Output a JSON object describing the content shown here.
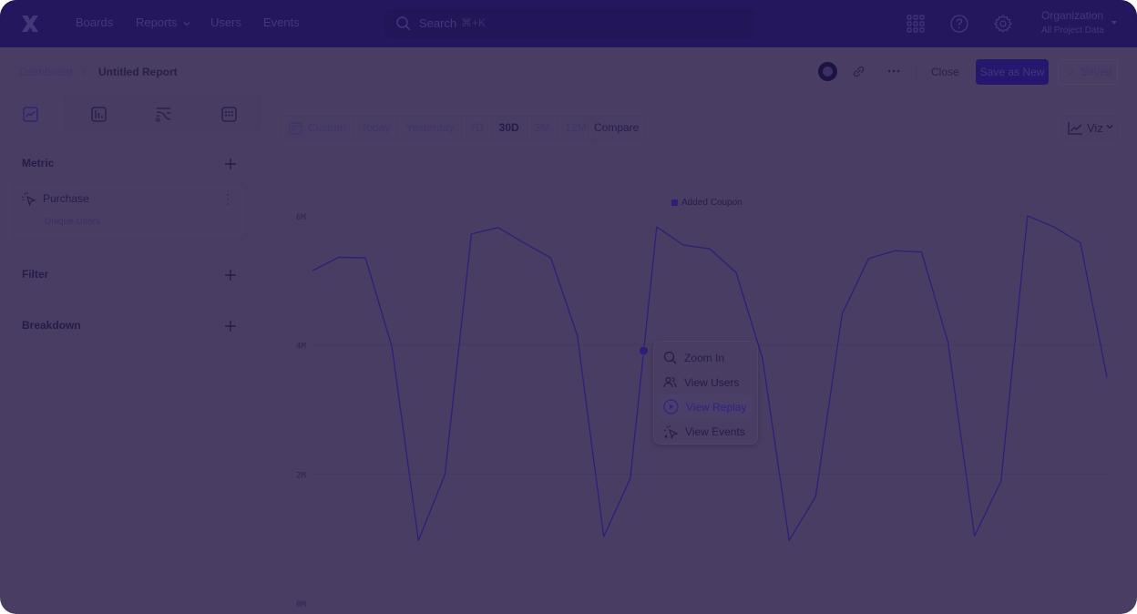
{
  "topnav": {
    "logo": "x-logo-icon",
    "links": [
      "Boards",
      "Reports",
      "Users",
      "Events"
    ],
    "search_placeholder": "Search",
    "search_shortcut": "⌘+K",
    "org_name": "Organization",
    "org_sub": "All Project Data"
  },
  "header": {
    "breadcrumb_root": "Dashboard",
    "breadcrumb_sep": "/",
    "title": "Untitled Report",
    "close_label": "Close",
    "save_new_label": "Save as New",
    "saved_label": "Saved",
    "saved_check": "✓"
  },
  "sidebar": {
    "tabs": [
      "insights-tab",
      "bar-chart-tab",
      "flows-tab",
      "grid-tab"
    ],
    "metric_label": "Metric",
    "metric_item": {
      "name": "Purchase",
      "sub": "Unique Users"
    },
    "filter_label": "Filter",
    "breakdown_label": "Breakdown"
  },
  "toolbar": {
    "ranges": [
      "Custom",
      "Today",
      "Yesterday",
      "7D",
      "30D",
      "3M",
      "12M"
    ],
    "active_range": "30D",
    "compare_label": "Compare",
    "viz_label": "Viz"
  },
  "menu": {
    "items": [
      {
        "label": "Zoom In",
        "icon": "magnifier-icon"
      },
      {
        "label": "View Users",
        "icon": "users-icon"
      },
      {
        "label": "View Replay",
        "icon": "play-circle-icon",
        "active": true
      },
      {
        "label": "View Events",
        "icon": "sparkle-cursor-icon"
      }
    ]
  },
  "colors": {
    "overlay": "#4a3d63",
    "nav": "#24175e",
    "accent": "#2d1f78",
    "line": "#2d1f78"
  },
  "chart_data": {
    "type": "line",
    "title": "",
    "legend": [
      "Added Coupon"
    ],
    "legend_position": "top-center",
    "xlabel": "",
    "ylabel": "",
    "ylim": [
      0,
      6
    ],
    "y_ticks": [
      "0M",
      "2M",
      "4M",
      "6M"
    ],
    "y_tick_values": [
      0,
      2,
      4,
      6
    ],
    "grid": true,
    "series": [
      {
        "name": "Added Coupon",
        "unit": "M",
        "values": [
          5.15,
          5.36,
          5.35,
          3.97,
          0.97,
          1.99,
          5.72,
          5.82,
          5.58,
          5.35,
          4.15,
          1.03,
          1.93,
          5.83,
          5.55,
          5.49,
          5.12,
          3.78,
          0.97,
          1.65,
          4.48,
          5.34,
          5.46,
          5.44,
          4.04,
          1.04,
          1.89,
          6.0,
          5.83,
          5.58,
          3.5
        ]
      }
    ],
    "hover_point": {
      "series": "Added Coupon",
      "index_between": [
        12,
        13
      ],
      "value": 3.91
    }
  }
}
